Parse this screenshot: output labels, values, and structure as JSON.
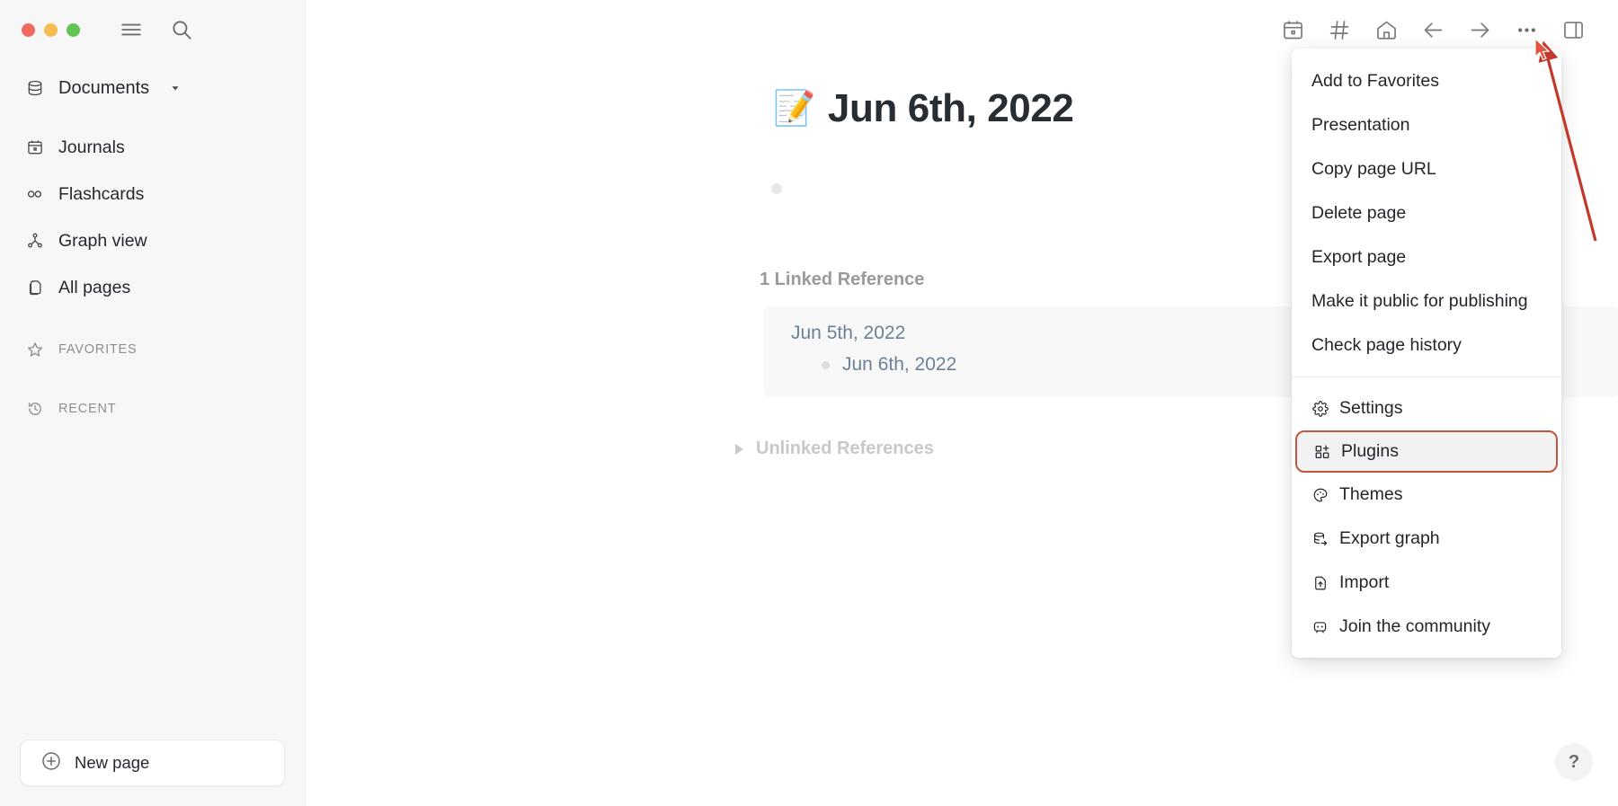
{
  "window": {
    "traffic_lights": [
      "close",
      "minimize",
      "maximize"
    ]
  },
  "sidebar": {
    "top_icons": [
      {
        "name": "menu-icon",
        "label": "Menu"
      },
      {
        "name": "search-icon",
        "label": "Search"
      }
    ],
    "graph_selector": {
      "label": "Documents",
      "icon": "database-icon"
    },
    "items": [
      {
        "label": "Journals",
        "icon": "calendar-icon"
      },
      {
        "label": "Flashcards",
        "icon": "infinity-icon"
      },
      {
        "label": "Graph view",
        "icon": "graph-icon"
      },
      {
        "label": "All pages",
        "icon": "pages-icon"
      }
    ],
    "sections": [
      {
        "label": "FAVORITES",
        "icon": "star-icon"
      },
      {
        "label": "RECENT",
        "icon": "history-icon"
      }
    ],
    "new_page_label": "New page"
  },
  "toolbar": {
    "buttons": [
      {
        "name": "calendar-icon",
        "label": "Journals"
      },
      {
        "name": "hash-icon",
        "label": "Tags"
      },
      {
        "name": "home-icon",
        "label": "Home"
      },
      {
        "name": "arrow-left-icon",
        "label": "Back"
      },
      {
        "name": "arrow-right-icon",
        "label": "Forward"
      },
      {
        "name": "more-icon",
        "label": "More options"
      },
      {
        "name": "right-sidebar-icon",
        "label": "Toggle right sidebar"
      }
    ]
  },
  "page": {
    "title": "Jun 6th, 2022",
    "title_emoji": "📝",
    "linked_references_heading": "1 Linked Reference",
    "linked_references": [
      {
        "parent": "Jun 5th, 2022",
        "children": [
          "Jun 6th, 2022"
        ]
      }
    ],
    "unlinked_references_label": "Unlinked References",
    "help_label": "?"
  },
  "dropdown": {
    "group1": [
      {
        "label": "Add to Favorites"
      },
      {
        "label": "Presentation"
      },
      {
        "label": "Copy page URL"
      },
      {
        "label": "Delete page"
      },
      {
        "label": "Export page"
      },
      {
        "label": "Make it public for publishing"
      },
      {
        "label": "Check page history"
      }
    ],
    "group2": [
      {
        "label": "Settings",
        "icon": "gear-icon",
        "highlighted": false
      },
      {
        "label": "Plugins",
        "icon": "plugins-icon",
        "highlighted": true
      },
      {
        "label": "Themes",
        "icon": "palette-icon",
        "highlighted": false
      },
      {
        "label": "Export graph",
        "icon": "export-graph-icon",
        "highlighted": false
      },
      {
        "label": "Import",
        "icon": "import-icon",
        "highlighted": false
      },
      {
        "label": "Join the community",
        "icon": "discord-icon",
        "highlighted": false
      }
    ]
  },
  "colors": {
    "sidebar_bg": "#f7f7f7",
    "main_bg": "#ffffff",
    "highlight_border": "#c2553c",
    "annotation_arrow": "#c0392b",
    "link_text": "#6c8196",
    "muted_text": "#9a9a9a"
  }
}
